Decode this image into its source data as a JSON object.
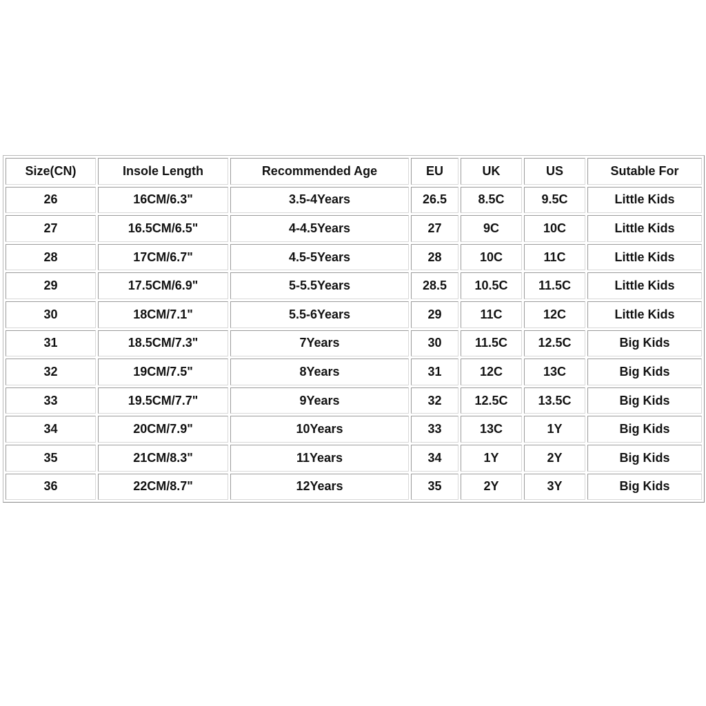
{
  "table": {
    "headers": [
      "Size(CN)",
      "Insole Length",
      "Recommended Age",
      "EU",
      "UK",
      "US",
      "Sutable For"
    ],
    "rows": [
      [
        "26",
        "16CM/6.3\"",
        "3.5-4Years",
        "26.5",
        "8.5C",
        "9.5C",
        "Little Kids"
      ],
      [
        "27",
        "16.5CM/6.5\"",
        "4-4.5Years",
        "27",
        "9C",
        "10C",
        "Little Kids"
      ],
      [
        "28",
        "17CM/6.7\"",
        "4.5-5Years",
        "28",
        "10C",
        "11C",
        "Little Kids"
      ],
      [
        "29",
        "17.5CM/6.9\"",
        "5-5.5Years",
        "28.5",
        "10.5C",
        "11.5C",
        "Little Kids"
      ],
      [
        "30",
        "18CM/7.1\"",
        "5.5-6Years",
        "29",
        "11C",
        "12C",
        "Little Kids"
      ],
      [
        "31",
        "18.5CM/7.3\"",
        "7Years",
        "30",
        "11.5C",
        "12.5C",
        "Big Kids"
      ],
      [
        "32",
        "19CM/7.5\"",
        "8Years",
        "31",
        "12C",
        "13C",
        "Big Kids"
      ],
      [
        "33",
        "19.5CM/7.7\"",
        "9Years",
        "32",
        "12.5C",
        "13.5C",
        "Big Kids"
      ],
      [
        "34",
        "20CM/7.9\"",
        "10Years",
        "33",
        "13C",
        "1Y",
        "Big Kids"
      ],
      [
        "35",
        "21CM/8.3\"",
        "11Years",
        "34",
        "1Y",
        "2Y",
        "Big Kids"
      ],
      [
        "36",
        "22CM/8.7\"",
        "12Years",
        "35",
        "2Y",
        "3Y",
        "Big Kids"
      ]
    ]
  }
}
